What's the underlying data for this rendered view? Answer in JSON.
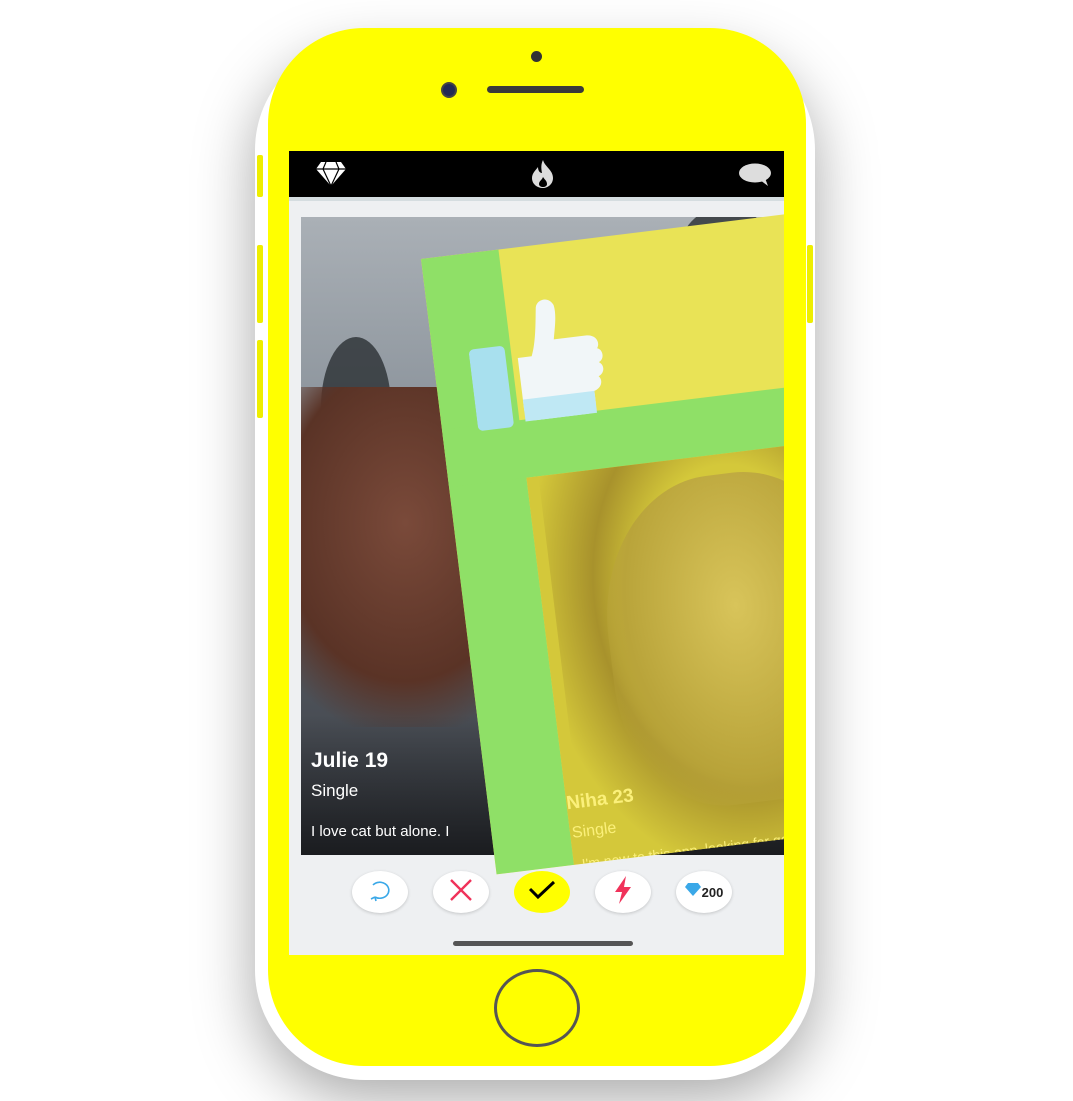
{
  "topbar": {
    "left_icon": "diamond-icon",
    "center_icon": "flame-icon",
    "right_icon": "chat-bubble-icon"
  },
  "cards": {
    "back": {
      "name": "Julie 19",
      "status": "Single",
      "bio": "I love cat but alone. I"
    },
    "front": {
      "name": "Niha 23",
      "status": "Single",
      "bio": "I'm new to this app, looking for good",
      "overlay_icon": "thumbs-up-icon"
    }
  },
  "actions": [
    {
      "id": "rewind",
      "icon": "rewind-icon"
    },
    {
      "id": "nope",
      "icon": "close-icon"
    },
    {
      "id": "like",
      "icon": "check-icon"
    },
    {
      "id": "boost",
      "icon": "lightning-icon"
    },
    {
      "id": "gems",
      "icon": "diamond-icon",
      "count": "200"
    }
  ],
  "colors": {
    "frame": "#ffff00",
    "topbar": "#000000",
    "nope_accent": "#f0325a",
    "rewind_accent": "#3aa8e8",
    "boost_accent": "#f0325a",
    "like_active": "#ffff00",
    "like_overlay": "#8fe067"
  }
}
